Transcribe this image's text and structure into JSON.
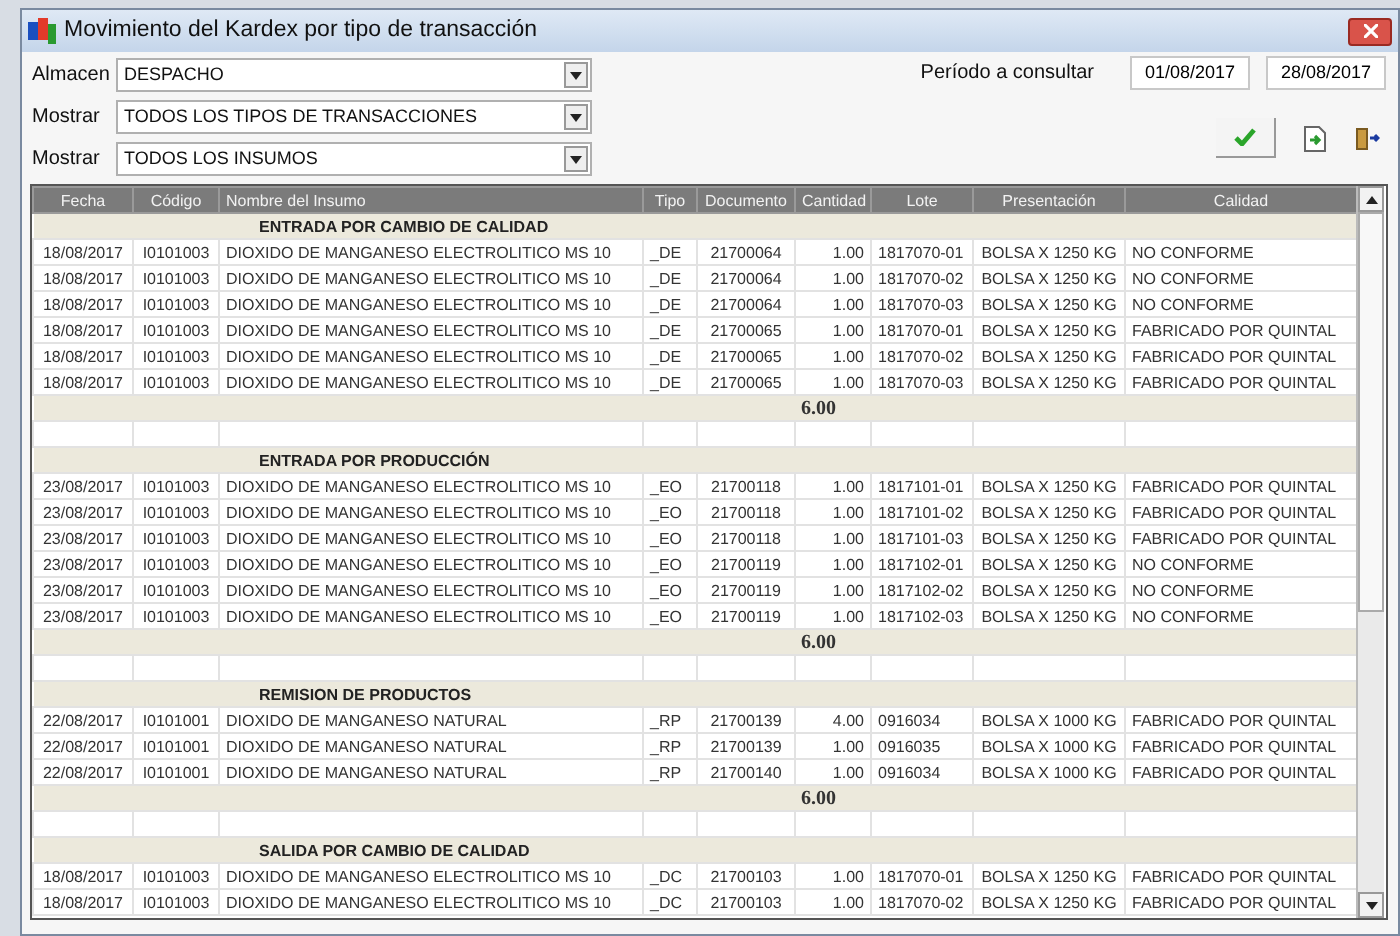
{
  "window": {
    "title": "Movimiento del Kardex por tipo de transacción"
  },
  "filters": [
    {
      "label": "Almacen",
      "value": "DESPACHO"
    },
    {
      "label": "Mostrar",
      "value": "TODOS LOS TIPOS DE TRANSACCIONES"
    },
    {
      "label": "Mostrar",
      "value": "TODOS LOS INSUMOS"
    }
  ],
  "period": {
    "label": "Período a consultar",
    "from": "01/08/2017",
    "to": "28/08/2017"
  },
  "table": {
    "columns": [
      "Fecha",
      "Código",
      "Nombre del Insumo",
      "Tipo",
      "Documento",
      "Cantidad",
      "Lote",
      "Presentación",
      "Calidad"
    ],
    "groups": [
      {
        "title": "ENTRADA POR CAMBIO DE CALIDAD",
        "total": "6.00",
        "rows": [
          [
            "18/08/2017",
            "I0101003",
            "DIOXIDO DE MANGANESO ELECTROLITICO MS 10",
            "_DE",
            "21700064",
            "1.00",
            "1817070-01",
            "BOLSA X 1250 KG",
            "NO CONFORME"
          ],
          [
            "18/08/2017",
            "I0101003",
            "DIOXIDO DE MANGANESO ELECTROLITICO MS 10",
            "_DE",
            "21700064",
            "1.00",
            "1817070-02",
            "BOLSA X 1250 KG",
            "NO CONFORME"
          ],
          [
            "18/08/2017",
            "I0101003",
            "DIOXIDO DE MANGANESO ELECTROLITICO MS 10",
            "_DE",
            "21700064",
            "1.00",
            "1817070-03",
            "BOLSA X 1250 KG",
            "NO CONFORME"
          ],
          [
            "18/08/2017",
            "I0101003",
            "DIOXIDO DE MANGANESO ELECTROLITICO MS 10",
            "_DE",
            "21700065",
            "1.00",
            "1817070-01",
            "BOLSA X 1250 KG",
            "FABRICADO POR QUINTAL"
          ],
          [
            "18/08/2017",
            "I0101003",
            "DIOXIDO DE MANGANESO ELECTROLITICO MS 10",
            "_DE",
            "21700065",
            "1.00",
            "1817070-02",
            "BOLSA X 1250 KG",
            "FABRICADO POR QUINTAL"
          ],
          [
            "18/08/2017",
            "I0101003",
            "DIOXIDO DE MANGANESO ELECTROLITICO MS 10",
            "_DE",
            "21700065",
            "1.00",
            "1817070-03",
            "BOLSA X 1250 KG",
            "FABRICADO POR QUINTAL"
          ]
        ]
      },
      {
        "title": "ENTRADA POR PRODUCCIÓN",
        "total": "6.00",
        "rows": [
          [
            "23/08/2017",
            "I0101003",
            "DIOXIDO DE MANGANESO ELECTROLITICO MS 10",
            "_EO",
            "21700118",
            "1.00",
            "1817101-01",
            "BOLSA X 1250 KG",
            "FABRICADO POR QUINTAL"
          ],
          [
            "23/08/2017",
            "I0101003",
            "DIOXIDO DE MANGANESO ELECTROLITICO MS 10",
            "_EO",
            "21700118",
            "1.00",
            "1817101-02",
            "BOLSA X 1250 KG",
            "FABRICADO POR QUINTAL"
          ],
          [
            "23/08/2017",
            "I0101003",
            "DIOXIDO DE MANGANESO ELECTROLITICO MS 10",
            "_EO",
            "21700118",
            "1.00",
            "1817101-03",
            "BOLSA X 1250 KG",
            "FABRICADO POR QUINTAL"
          ],
          [
            "23/08/2017",
            "I0101003",
            "DIOXIDO DE MANGANESO ELECTROLITICO MS 10",
            "_EO",
            "21700119",
            "1.00",
            "1817102-01",
            "BOLSA X 1250 KG",
            "NO CONFORME"
          ],
          [
            "23/08/2017",
            "I0101003",
            "DIOXIDO DE MANGANESO ELECTROLITICO MS 10",
            "_EO",
            "21700119",
            "1.00",
            "1817102-02",
            "BOLSA X 1250 KG",
            "NO CONFORME"
          ],
          [
            "23/08/2017",
            "I0101003",
            "DIOXIDO DE MANGANESO ELECTROLITICO MS 10",
            "_EO",
            "21700119",
            "1.00",
            "1817102-03",
            "BOLSA X 1250 KG",
            "NO CONFORME"
          ]
        ]
      },
      {
        "title": "REMISION DE PRODUCTOS",
        "total": "6.00",
        "rows": [
          [
            "22/08/2017",
            "I0101001",
            "DIOXIDO DE MANGANESO NATURAL",
            "_RP",
            "21700139",
            "4.00",
            "0916034",
            "BOLSA X 1000 KG",
            "FABRICADO POR QUINTAL"
          ],
          [
            "22/08/2017",
            "I0101001",
            "DIOXIDO DE MANGANESO NATURAL",
            "_RP",
            "21700139",
            "1.00",
            "0916035",
            "BOLSA X 1000 KG",
            "FABRICADO POR QUINTAL"
          ],
          [
            "22/08/2017",
            "I0101001",
            "DIOXIDO DE MANGANESO NATURAL",
            "_RP",
            "21700140",
            "1.00",
            "0916034",
            "BOLSA X 1000 KG",
            "FABRICADO POR QUINTAL"
          ]
        ]
      },
      {
        "title": "SALIDA POR CAMBIO DE CALIDAD",
        "rows": [
          [
            "18/08/2017",
            "I0101003",
            "DIOXIDO DE MANGANESO ELECTROLITICO MS 10",
            "_DC",
            "21700103",
            "1.00",
            "1817070-01",
            "BOLSA X 1250 KG",
            "FABRICADO POR QUINTAL"
          ],
          [
            "18/08/2017",
            "I0101003",
            "DIOXIDO DE MANGANESO ELECTROLITICO MS 10",
            "_DC",
            "21700103",
            "1.00",
            "1817070-02",
            "BOLSA X 1250 KG",
            "FABRICADO POR QUINTAL"
          ]
        ]
      }
    ]
  }
}
